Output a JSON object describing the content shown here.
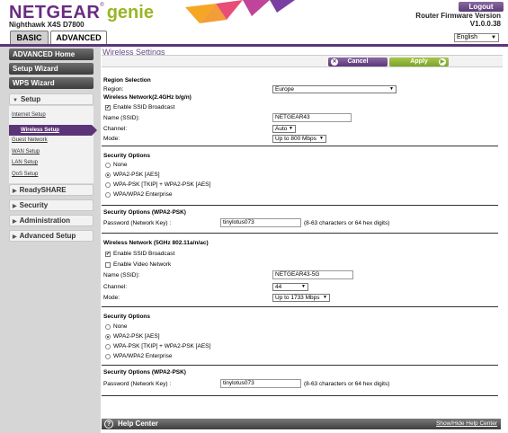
{
  "header": {
    "brand": "NETGEAR",
    "brand_reg": "®",
    "product": "genie",
    "model": "Nighthawk X4S D7800",
    "logout": "Logout",
    "firmware_label": "Router Firmware Version",
    "firmware_version": "V1.0.0.38",
    "tabs": {
      "basic": "BASIC",
      "advanced": "ADVANCED"
    },
    "language": "English"
  },
  "sidebar": {
    "advanced_home": "ADVANCED Home",
    "setup_wizard": "Setup Wizard",
    "wps_wizard": "WPS Wizard",
    "setup": "Setup",
    "sub": [
      "Internet Setup",
      "Wireless Setup",
      "Guest Network",
      "WAN Setup",
      "LAN Setup",
      "QoS Setup"
    ],
    "readyshare": "ReadySHARE",
    "security": "Security",
    "administration": "Administration",
    "advanced_setup": "Advanced Setup"
  },
  "main": {
    "title": "Wireless Settings",
    "cancel": "Cancel",
    "apply": "Apply",
    "region_heading": "Region Selection",
    "region_label": "Region:",
    "region_value": "Europe",
    "wn24": {
      "heading": "Wireless Network(2.4GHz b/g/n)",
      "ssid_broadcast": "Enable SSID Broadcast",
      "name_label": "Name (SSID):",
      "name_value": "NETGEAR43",
      "channel_label": "Channel:",
      "channel_value": "Auto",
      "mode_label": "Mode:",
      "mode_value": "Up to 800 Mbps"
    },
    "sec24": {
      "heading": "Security Options",
      "options": [
        "None",
        "WPA2-PSK [AES]",
        "WPA-PSK [TKIP] + WPA2-PSK [AES]",
        "WPA/WPA2 Enterprise"
      ],
      "psk_heading": "Security Options (WPA2-PSK)",
      "key_label": "Password (Network Key) :",
      "key_value": "tinylotus073",
      "key_hint": "(8-63 characters or 64 hex digits)"
    },
    "wn5": {
      "heading": "Wireless Network (5GHz 802.11a/n/ac)",
      "ssid_broadcast": "Enable SSID Broadcast",
      "video_network": "Enable Video Network",
      "name_label": "Name (SSID):",
      "name_value": "NETGEAR43-5G",
      "channel_label": "Channel:",
      "channel_value": "44",
      "mode_label": "Mode:",
      "mode_value": "Up to 1733 Mbps"
    },
    "sec5": {
      "heading": "Security Options",
      "options": [
        "None",
        "WPA2-PSK [AES]",
        "WPA-PSK [TKIP] + WPA2-PSK [AES]",
        "WPA/WPA2 Enterprise"
      ],
      "psk_heading": "Security Options (WPA2-PSK)",
      "key_label": "Password (Network Key) :",
      "key_value": "tinylotus073",
      "key_hint": "(8-63 characters or 64 hex digits)"
    }
  },
  "help": {
    "label": "Help Center",
    "toggle": "Show/Hide Help Center"
  }
}
